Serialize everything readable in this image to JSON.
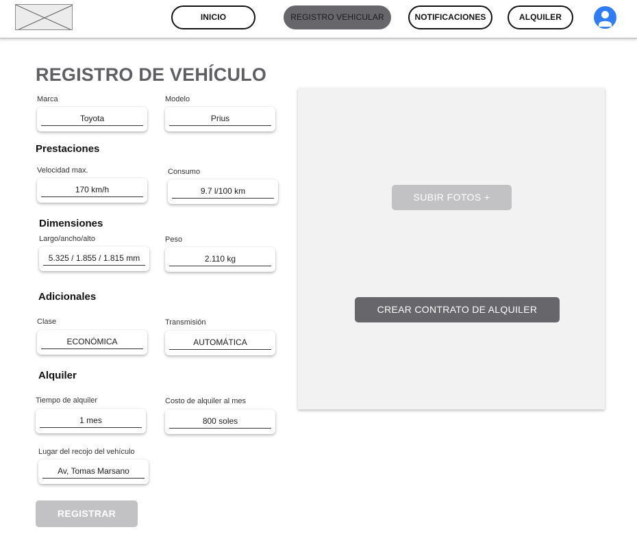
{
  "header": {
    "logo_icon": "image-placeholder-icon",
    "nav": {
      "inicio": "INICIO",
      "registro": "REGISTRO VEHICULAR",
      "notificaciones": "NOTIFICACIONES",
      "alquiler": "ALQUILER"
    },
    "active_tab": "REGISTRO VEHICULAR",
    "avatar_icon": "user-avatar-icon"
  },
  "page": {
    "title": "REGISTRO DE VEHÍCULO"
  },
  "form": {
    "marca": {
      "label": "Marca",
      "value": "Toyota"
    },
    "modelo": {
      "label": "Modelo",
      "value": "Prius"
    },
    "prestaciones_heading": "Prestaciones",
    "velocidad": {
      "label": "Velocidad max.",
      "value": "170 km/h"
    },
    "consumo": {
      "label": "Consumo",
      "value": "9.7 l/100 km"
    },
    "dimensiones_heading": "Dimensiones",
    "dimensiones": {
      "label": "Largo/ancho/alto",
      "value": "5.325 / 1.855 / 1.815 mm"
    },
    "peso": {
      "label": "Peso",
      "value": "2.110 kg"
    },
    "adicionales_heading": "Adicionales",
    "clase": {
      "label": "Clase",
      "value": "ECONÓMICA"
    },
    "transmision": {
      "label": "Transmisión",
      "value": "AUTOMÁTICA"
    },
    "alquiler_heading": "Alquiler",
    "tiempo": {
      "label": "Tiempo de alquiler",
      "value": "1 mes"
    },
    "costo": {
      "label": "Costo de alquiler al mes",
      "value": "800 soles"
    },
    "lugar": {
      "label": "Lugar del recojo del vehículo",
      "value": "Av, Tomas Marsano"
    },
    "submit_label": "REGISTRAR"
  },
  "panel": {
    "upload_label": "SUBIR FOTOS +",
    "contract_label": "CREAR CONTRATO DE ALQUILER"
  },
  "colors": {
    "accent_dark": "#67666b",
    "disabled": "#c2c2c4",
    "avatar_blue": "#2f7df6",
    "title_gray": "#5f5f63"
  }
}
